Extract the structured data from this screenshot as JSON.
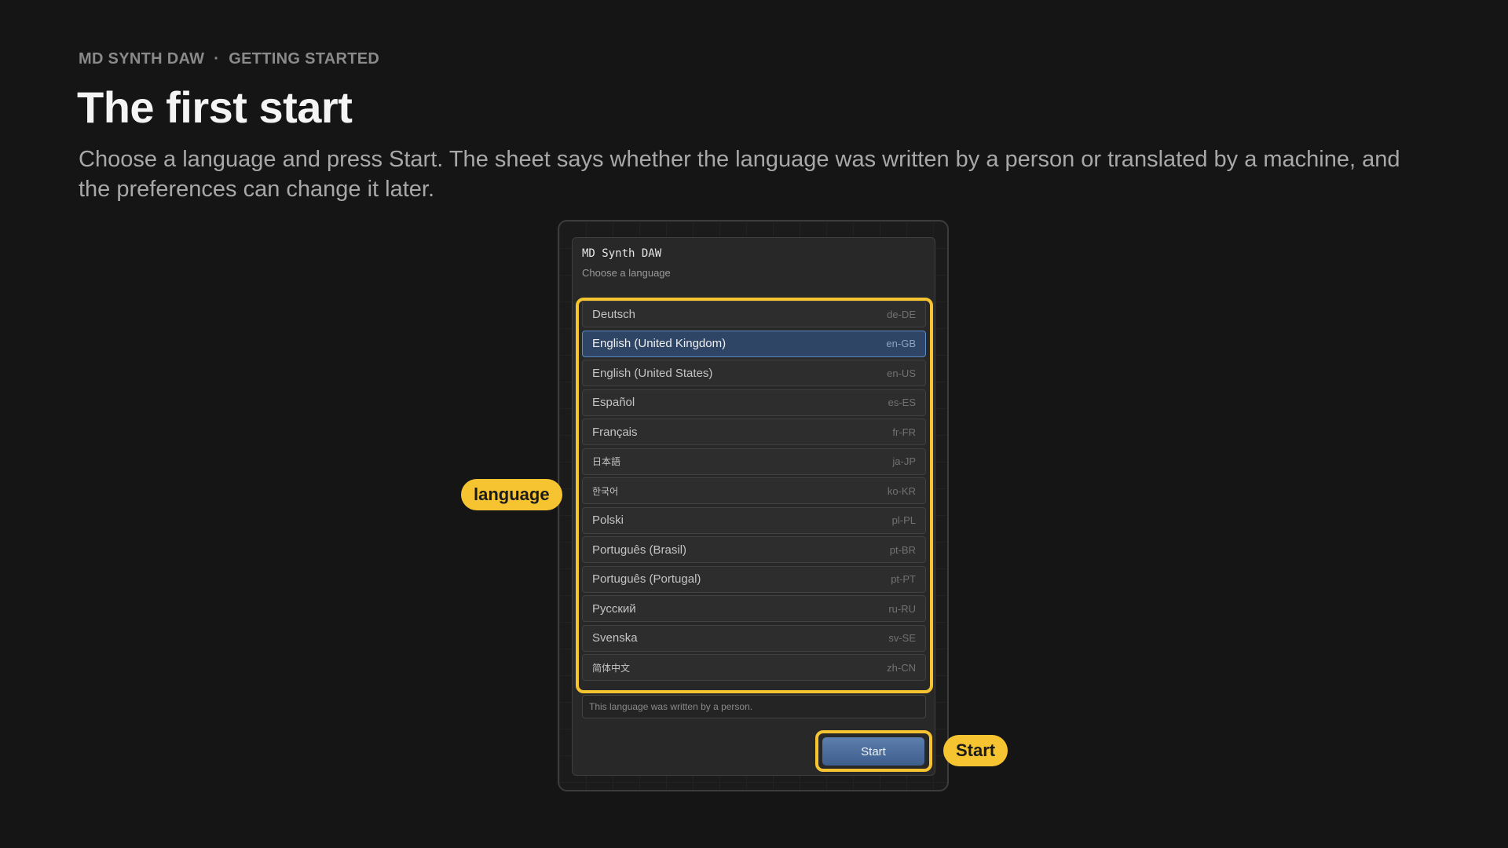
{
  "header": {
    "app_name": "MD SYNTH DAW",
    "separator": "·",
    "section": "GETTING STARTED",
    "title": "The first start",
    "lead": "Choose a language and press Start. The sheet says whether the language was written by a person or translated by a machine, and the preferences can change it later."
  },
  "sheet": {
    "title": "MD Synth DAW",
    "subtitle": "Choose a language",
    "languages": [
      {
        "name": "Deutsch",
        "code": "de-DE",
        "selected": false
      },
      {
        "name": "English (United Kingdom)",
        "code": "en-GB",
        "selected": true
      },
      {
        "name": "English (United States)",
        "code": "en-US",
        "selected": false
      },
      {
        "name": "Español",
        "code": "es-ES",
        "selected": false
      },
      {
        "name": "Français",
        "code": "fr-FR",
        "selected": false
      },
      {
        "name": "日本語",
        "code": "ja-JP",
        "selected": false
      },
      {
        "name": "한국어",
        "code": "ko-KR",
        "selected": false
      },
      {
        "name": "Polski",
        "code": "pl-PL",
        "selected": false
      },
      {
        "name": "Português (Brasil)",
        "code": "pt-BR",
        "selected": false
      },
      {
        "name": "Português (Portugal)",
        "code": "pt-PT",
        "selected": false
      },
      {
        "name": "Русский",
        "code": "ru-RU",
        "selected": false
      },
      {
        "name": "Svenska",
        "code": "sv-SE",
        "selected": false
      },
      {
        "name": "简体中文",
        "code": "zh-CN",
        "selected": false
      }
    ],
    "note": "This language was written by a person.",
    "start_label": "Start"
  },
  "callouts": {
    "language": "language",
    "start": "Start"
  },
  "colors": {
    "background": "#151515",
    "highlight": "#f6c331",
    "selected_row": "#2e4566",
    "start_button": "#4a6b9a"
  }
}
